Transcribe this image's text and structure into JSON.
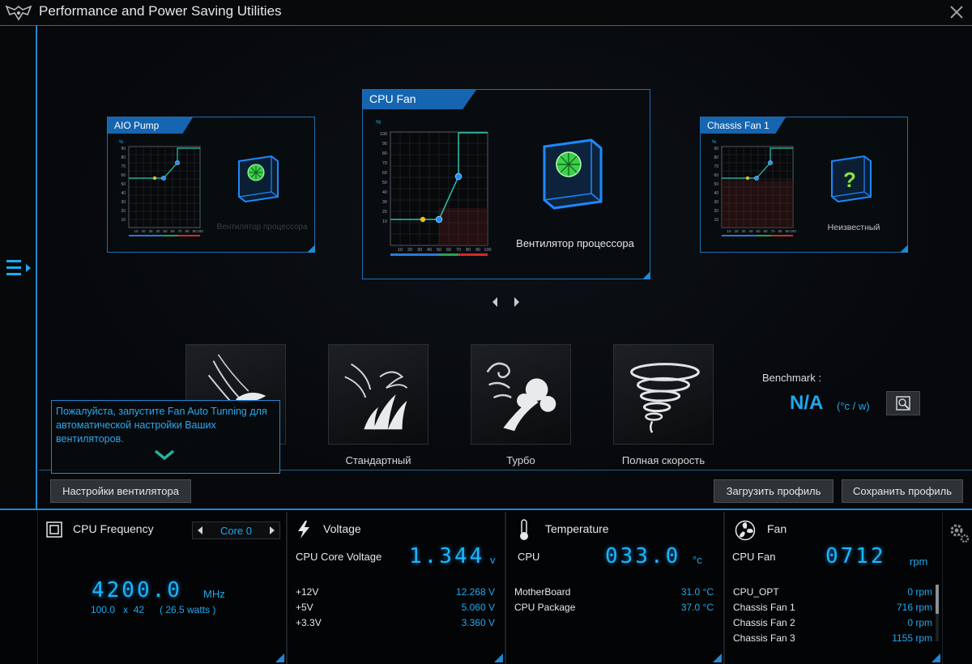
{
  "window": {
    "title": "Performance and Power Saving Utilities"
  },
  "fans": {
    "aio": {
      "tab": "AIO Pump",
      "label": "Вентилятор процессора"
    },
    "cpu": {
      "tab": "CPU Fan",
      "label": "Вентилятор процессора"
    },
    "chassis": {
      "tab": "Chassis Fan 1",
      "label": "Неизвестный"
    }
  },
  "chart_axes": {
    "y_unit": "%",
    "y_ticks": [
      "100",
      "90",
      "80",
      "70",
      "60",
      "50",
      "40",
      "30",
      "20",
      "10"
    ],
    "x_ticks": [
      "10",
      "20",
      "30",
      "40",
      "50",
      "60",
      "70",
      "80",
      "90",
      "100"
    ],
    "x_unit": "°c"
  },
  "modes": [
    {
      "label": ""
    },
    {
      "label": "Стандартный"
    },
    {
      "label": "Турбо"
    },
    {
      "label": "Полная скорость"
    }
  ],
  "benchmark": {
    "label": "Benchmark :",
    "value": "N/A",
    "unit": "(°c / w)"
  },
  "tooltip": {
    "text": "Пожалуйста, запустите Fan Auto Tunning для автоматической настройки Ваших вентиляторов."
  },
  "buttons": {
    "fan_settings": "Настройки вентилятора",
    "load_profile": "Загрузить профиль",
    "save_profile": "Сохранить профиль"
  },
  "cpu_freq": {
    "title": "CPU Frequency",
    "core": "Core 0",
    "value": "4200.0",
    "unit": "MHz",
    "ratio": "100.0   x  42",
    "watts": "( 26.5 watts )"
  },
  "voltage": {
    "title": "Voltage",
    "main_label": "CPU Core Voltage",
    "main_value": "1.344",
    "main_unit": "v",
    "rows": [
      {
        "label": "+12V",
        "value": "12.268  V"
      },
      {
        "label": "+5V",
        "value": "5.060  V"
      },
      {
        "label": "+3.3V",
        "value": "3.360  V"
      }
    ]
  },
  "temperature": {
    "title": "Temperature",
    "main_label": "CPU",
    "main_value": "033.0",
    "main_unit": "°c",
    "rows": [
      {
        "label": "MotherBoard",
        "value": "31.0 °C"
      },
      {
        "label": "CPU Package",
        "value": "37.0 °C"
      }
    ]
  },
  "fan": {
    "title": "Fan",
    "main_label": "CPU Fan",
    "main_value": "0712",
    "main_unit": "rpm",
    "rows": [
      {
        "label": "CPU_OPT",
        "value": "0  rpm"
      },
      {
        "label": "Chassis Fan 1",
        "value": "716  rpm"
      },
      {
        "label": "Chassis Fan 2",
        "value": "0  rpm"
      },
      {
        "label": "Chassis Fan 3",
        "value": "1155  rpm"
      }
    ]
  },
  "colors": {
    "accent": "#1e88d4",
    "value_blue": "#1ea9f0",
    "curve": "#26c6b0",
    "point": "#1e90ff",
    "marker": "#e0c020"
  },
  "icons": {
    "logo": "tuf-logo-icon",
    "close": "close-icon",
    "menu": "menu-icon",
    "benchmark": "benchmark-search-icon",
    "settings": "gear-icon",
    "cpu": "cpu-chip-icon",
    "voltage": "lightning-icon",
    "temperature": "thermometer-icon",
    "fan": "fan-icon"
  }
}
